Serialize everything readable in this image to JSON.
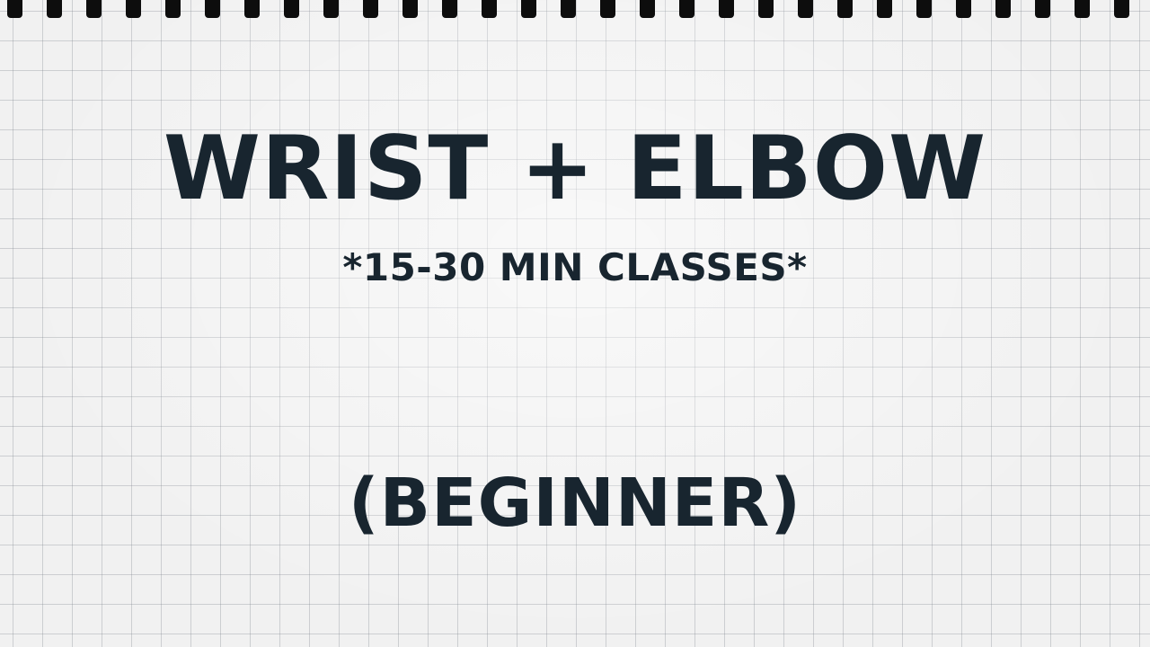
{
  "title": "WRIST + ELBOW",
  "subtitle": "*15-30 MIN CLASSES*",
  "level": "(BEGINNER)",
  "colors": {
    "text": "#18252f",
    "paper": "#f1f1f1",
    "grid": "#787d87",
    "binding": "#0d0d0d"
  }
}
